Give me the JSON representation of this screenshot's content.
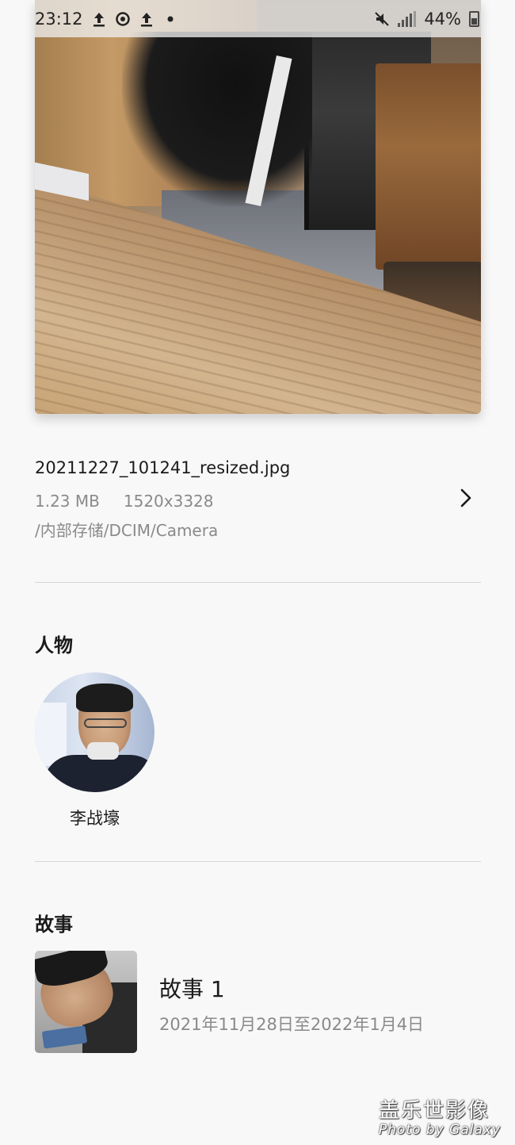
{
  "status_bar": {
    "time": "23:12",
    "battery": "44%",
    "icons_left": [
      "upload-icon",
      "sync-icon",
      "upload-icon",
      "dot-icon"
    ],
    "icons_right": [
      "mute-icon",
      "signal-icon",
      "battery-icon"
    ]
  },
  "file": {
    "name": "20211227_101241_resized.jpg",
    "size": "1.23 MB",
    "resolution": "1520x3328",
    "path": "/内部存储/DCIM/Camera"
  },
  "people": {
    "title": "人物",
    "items": [
      {
        "name": "李战壕"
      }
    ]
  },
  "stories": {
    "title": "故事",
    "items": [
      {
        "title": "故事 1",
        "date_range": "2021年11月28日至2022年1月4日"
      }
    ]
  },
  "watermark": {
    "line1": "盖乐世影像",
    "line2": "Photo by Galaxy"
  }
}
